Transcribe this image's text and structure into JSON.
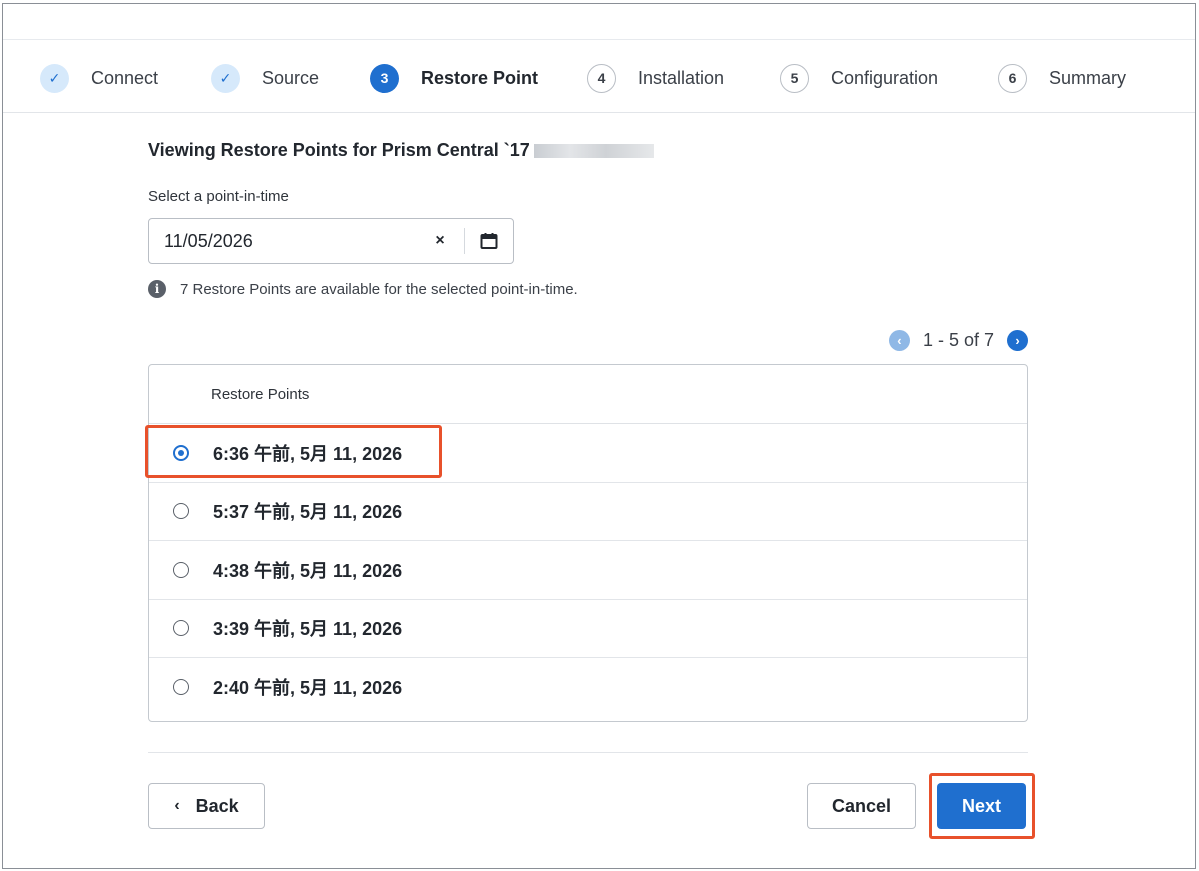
{
  "stepper": {
    "steps": [
      {
        "marker": "✓",
        "label": "Connect",
        "state": "done"
      },
      {
        "marker": "✓",
        "label": "Source",
        "state": "done"
      },
      {
        "marker": "3",
        "label": "Restore Point",
        "state": "active"
      },
      {
        "marker": "4",
        "label": "Installation",
        "state": "todo"
      },
      {
        "marker": "5",
        "label": "Configuration",
        "state": "todo"
      },
      {
        "marker": "6",
        "label": "Summary",
        "state": "todo"
      }
    ]
  },
  "main": {
    "title": "Viewing Restore Points for Prism Central `17",
    "field_label": "Select a point-in-time",
    "date_value": "11/05/2026",
    "clear_symbol": "×",
    "info_text": "7 Restore Points are available for the selected point-in-time.",
    "info_symbol": "i"
  },
  "pager": {
    "text": "1 - 5 of 7",
    "prev_symbol": "‹",
    "next_symbol": "›"
  },
  "table": {
    "header": "Restore Points",
    "rows": [
      {
        "label": "6:36 午前, 5月 11, 2026",
        "selected": true
      },
      {
        "label": "5:37 午前, 5月 11, 2026",
        "selected": false
      },
      {
        "label": "4:38 午前, 5月 11, 2026",
        "selected": false
      },
      {
        "label": "3:39 午前, 5月 11, 2026",
        "selected": false
      },
      {
        "label": "2:40 午前, 5月 11, 2026",
        "selected": false
      }
    ]
  },
  "footer": {
    "back_label": "Back",
    "back_symbol": "‹",
    "cancel_label": "Cancel",
    "next_label": "Next"
  },
  "colors": {
    "accent": "#1f6fcf",
    "highlight": "#e8512b"
  }
}
